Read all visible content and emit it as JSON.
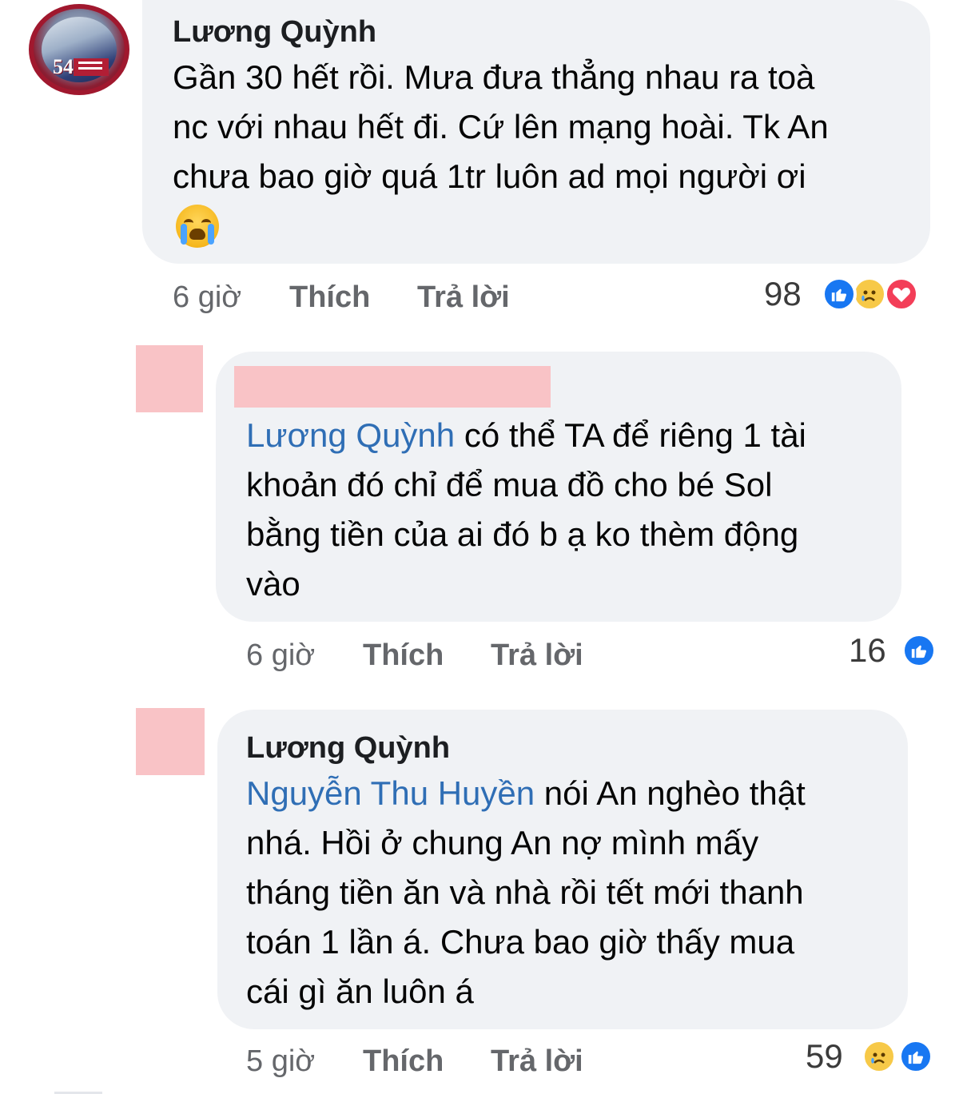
{
  "comments": [
    {
      "author": "Lương Quỳnh",
      "lines": [
        "Gần 30 hết rồi. Mưa đưa thẳng nhau ra toà",
        "nc với nhau hết đi. Cứ lên mạng hoài. Tk An",
        "chưa bao giờ quá 1tr luôn ad mọi người ơi"
      ],
      "time": "6 giờ",
      "like_label": "Thích",
      "reply_label": "Trả lời",
      "reaction_count": "98",
      "reactions": [
        "like-icon",
        "sad-icon",
        "love-icon"
      ]
    },
    {
      "author": "",
      "mention": "Lương Quỳnh",
      "first_line_rest": " có thể TA để riêng 1 tài",
      "lines": [
        "khoản đó chỉ để mua đồ cho bé Sol",
        "bằng tiền của ai đó b ạ ko thèm động",
        "vào"
      ],
      "time": "6 giờ",
      "like_label": "Thích",
      "reply_label": "Trả lời",
      "reaction_count": "16",
      "reactions": [
        "like-icon"
      ]
    },
    {
      "author": "Lương Quỳnh",
      "mention": "Nguyễn Thu Huyền",
      "first_line_rest": " nói An nghèo thật",
      "lines": [
        "nhá. Hồi ở chung An nợ mình mấy",
        "tháng tiền ăn và nhà rồi tết mới thanh",
        "toán 1 lần á. Chưa bao giờ thấy mua",
        "cái gì ăn luôn á"
      ],
      "time": "5 giờ",
      "like_label": "Thích",
      "reply_label": "Trả lời",
      "reaction_count": "59",
      "reactions": [
        "sad-icon",
        "like-icon"
      ]
    }
  ],
  "colors": {
    "bubble": "#f0f2f5",
    "mention": "#2f6eb5",
    "like": "#1877f2",
    "love": "#f33e58",
    "sad": "#f7c948",
    "redaction": "#f9c3c6"
  }
}
